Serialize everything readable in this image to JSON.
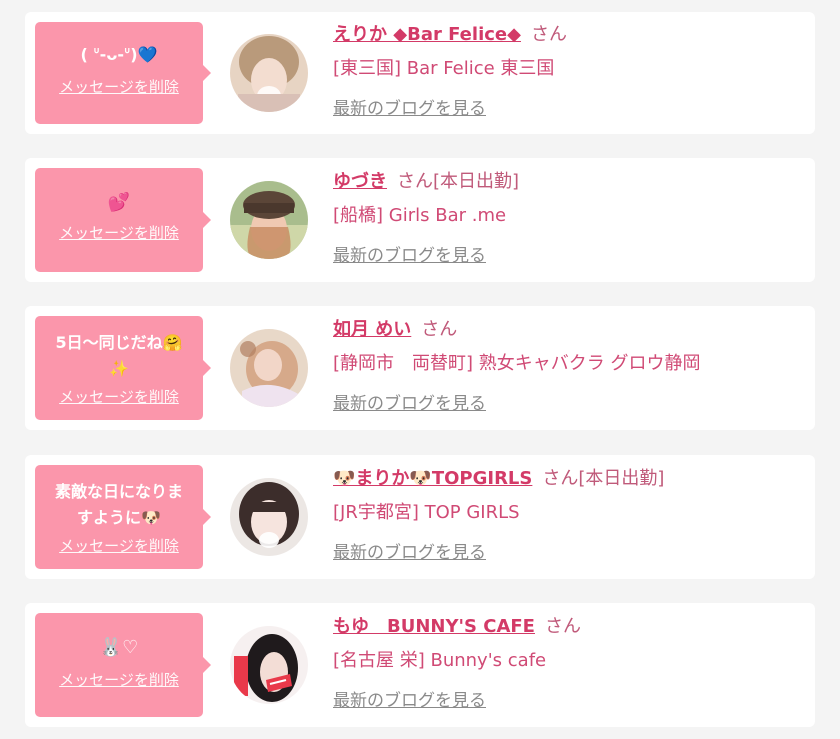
{
  "entries": [
    {
      "message": "( ᐡ-ᴗ-ᐡ)💙",
      "message_line2": "",
      "delete_label": "メッセージを削除",
      "name": "えりか ◆Bar Felice◆",
      "honorific": "さん",
      "status": "",
      "shop": "[東三国] Bar Felice 東三国",
      "blog_label": "最新のブログを見る"
    },
    {
      "message": "💕",
      "message_line2": "",
      "delete_label": "メッセージを削除",
      "name": "ゆづき",
      "honorific": "さん",
      "status": "[本日出勤]",
      "shop": "[船橋] Girls Bar .me",
      "blog_label": "最新のブログを見る"
    },
    {
      "message": "5日〜同じだね🤗",
      "message_line2": "✨",
      "delete_label": "メッセージを削除",
      "name": "如月 めい",
      "honorific": "さん",
      "status": "",
      "shop": "[静岡市　両替町] 熟女キャバクラ グロウ静岡",
      "blog_label": "最新のブログを見る"
    },
    {
      "message": "素敵な日になりま",
      "message_line2": "すように🐶",
      "delete_label": "メッセージを削除",
      "name": "🐶まりか🐶TOPGIRLS",
      "honorific": "さん",
      "status": "[本日出勤]",
      "shop": "[JR宇都宮] TOP GIRLS",
      "blog_label": "最新のブログを見る"
    },
    {
      "message": "🐰♡",
      "message_line2": "",
      "delete_label": "メッセージを削除",
      "name": "もゆ　BUNNY'S CAFE",
      "honorific": "さん",
      "status": "",
      "shop": "[名古屋 栄] Bunny's cafe",
      "blog_label": "最新のブログを見る"
    }
  ],
  "colors": {
    "bubble": "#fb96ab",
    "name": "#d33a67",
    "shop": "#d04a75",
    "blog": "#8a8a8a",
    "page_bg": "#f4f4f4"
  }
}
